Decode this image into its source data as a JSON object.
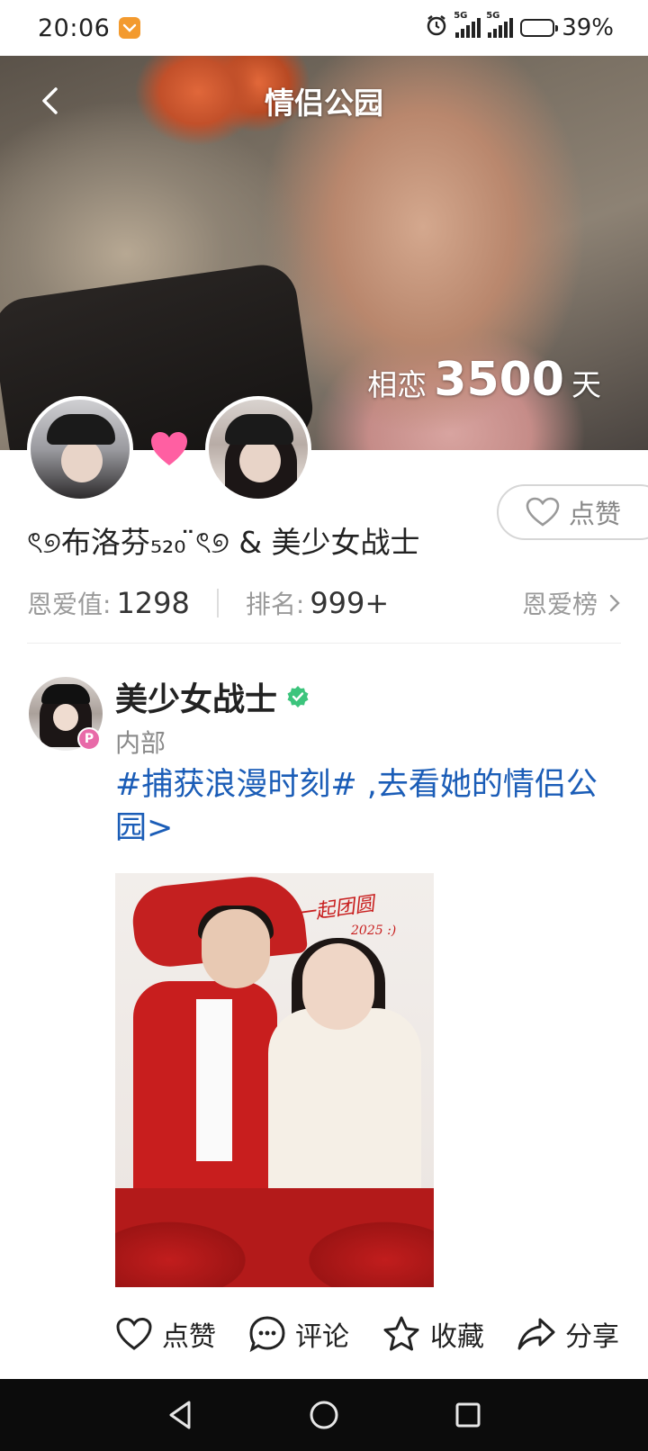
{
  "status_bar": {
    "time": "20:06",
    "battery_percent": "39%",
    "battery_level": 0.39,
    "network_1": "5G",
    "network_2": "5G",
    "icons": [
      "alarm-icon",
      "signal-5g-icon",
      "signal-5g-icon",
      "battery-icon"
    ]
  },
  "header": {
    "title": "情侣公园",
    "back_icon": "chevron-left-icon"
  },
  "hero": {
    "days_prefix": "相恋",
    "days_count": "3500",
    "days_unit": "天"
  },
  "couple": {
    "names": "ৎ୭布洛芬₅₂₀ ̈ৎ୭ & 美少女战士",
    "heart_color": "#ff5fa2"
  },
  "like_button": {
    "label": "点赞",
    "icon": "heart-outline-icon"
  },
  "stats": {
    "love_label": "恩爱值:",
    "love_value": "1298",
    "rank_label": "排名:",
    "rank_value": "999+",
    "board_label": "恩爱榜"
  },
  "post": {
    "author": "美少女战士",
    "verified_color": "#3cc47c",
    "badge": "P",
    "subtitle": "内部",
    "text": "#捕获浪漫时刻# ,去看她的情侣公园>",
    "image_script": "一起团圆",
    "image_script_year": "2025 :)"
  },
  "actions": [
    {
      "label": "点赞",
      "icon": "heart-outline-icon"
    },
    {
      "label": "评论",
      "icon": "comment-icon"
    },
    {
      "label": "收藏",
      "icon": "star-outline-icon"
    },
    {
      "label": "分享",
      "icon": "share-icon"
    }
  ],
  "nav": [
    "back-triangle-icon",
    "home-circle-icon",
    "recents-square-icon"
  ],
  "colors": {
    "link_blue": "#1b5db7",
    "accent_pink": "#ff5fa2",
    "text_gray": "#9a9a9a"
  }
}
